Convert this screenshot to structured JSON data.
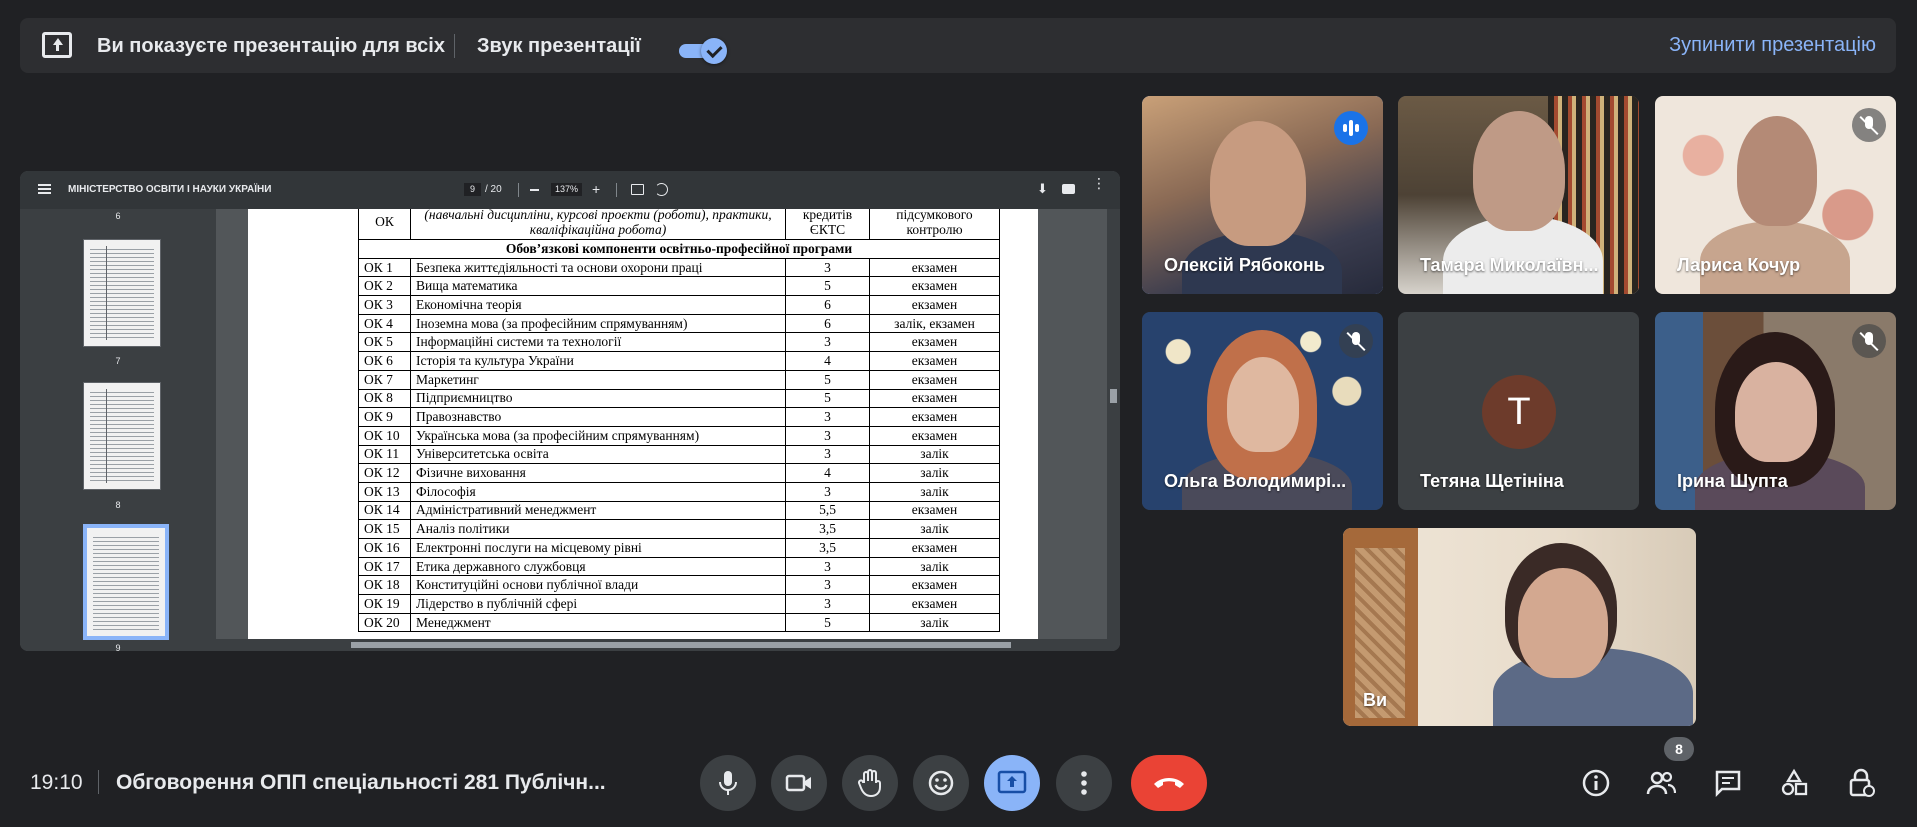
{
  "banner": {
    "message": "Ви показуєте презентацію для всіх",
    "sound_label": "Звук презентації",
    "sound_on": true,
    "stop_label": "Зупинити презентацію"
  },
  "pdf": {
    "title": "МІНІСТЕРСТВО ОСВІТИ І НАУКИ УКРАЇНИ",
    "page": "9",
    "page_total": "/ 20",
    "zoom": "137%",
    "thumbnails": [
      "6",
      "7",
      "8",
      "9"
    ],
    "table": {
      "header": [
        "ОК",
        "(навчальні дисципліни, курсові проєкти (роботи), практики, кваліфікаційна робота)",
        "кредитів ЄКТС",
        "підсумкового контролю"
      ],
      "section": "Обов’язкові компоненти освітньо-професійної програми",
      "rows": [
        [
          "ОК 1",
          "Безпека життєдіяльності та основи охорони праці",
          "3",
          "екзамен"
        ],
        [
          "ОК 2",
          "Вища математика",
          "5",
          "екзамен"
        ],
        [
          "ОК 3",
          "Економічна теорія",
          "6",
          "екзамен"
        ],
        [
          "ОК 4",
          "Іноземна мова (за професійним спрямуванням)",
          "6",
          "залік, екзамен"
        ],
        [
          "ОК 5",
          "Інформаційні системи та технології",
          "3",
          "екзамен"
        ],
        [
          "ОК 6",
          "Історія та культура України",
          "4",
          "екзамен"
        ],
        [
          "ОК 7",
          "Маркетинг",
          "5",
          "екзамен"
        ],
        [
          "ОК 8",
          "Підприємництво",
          "5",
          "екзамен"
        ],
        [
          "ОК 9",
          "Правознавство",
          "3",
          "екзамен"
        ],
        [
          "ОК 10",
          "Українська мова (за професійним спрямуванням)",
          "3",
          "екзамен"
        ],
        [
          "ОК 11",
          "Університетська освіта",
          "3",
          "залік"
        ],
        [
          "ОК 12",
          "Фізичне виховання",
          "4",
          "залік"
        ],
        [
          "ОК 13",
          "Філософія",
          "3",
          "залік"
        ],
        [
          "ОК 14",
          "Адміністративний менеджмент",
          "5,5",
          "екзамен"
        ],
        [
          "ОК 15",
          "Аналіз політики",
          "3,5",
          "залік"
        ],
        [
          "ОК 16",
          " Електронні послуги на місцевому рівні",
          "3,5",
          "екзамен"
        ],
        [
          "ОК 17",
          "Етика державного службовця",
          "3",
          "залік"
        ],
        [
          "ОК 18",
          "Конституційні основи публічної влади",
          "3",
          "екзамен"
        ],
        [
          "ОК 19",
          "Лідерство в публічній сфері",
          "3",
          "екзамен"
        ],
        [
          "ОК 20",
          "Менеджмент",
          "5",
          "залік"
        ]
      ]
    }
  },
  "participants": [
    {
      "name": "Олексій Рябоконь",
      "speaking": true
    },
    {
      "name": "Тамара Миколаївн...",
      "muted": false
    },
    {
      "name": "Лариса Кочур",
      "muted": true
    },
    {
      "name": "Ольга Володимирі...",
      "muted": true
    },
    {
      "name": "Тетяна Щетініна",
      "initial": "T"
    },
    {
      "name": "Ірина Шупта",
      "muted": true
    },
    {
      "name": "Ви"
    }
  ],
  "bottom": {
    "time": "19:10",
    "meeting_title": "Обговорення ОПП спеціальності 281 Публічн...",
    "participant_count": "8"
  },
  "colors": {
    "accent": "#8ab4f8",
    "hangup": "#ea4335",
    "bg": "#202124"
  },
  "icons": [
    "present-icon",
    "mic-icon",
    "camera-icon",
    "hand-icon",
    "emoji-icon",
    "present-now-icon",
    "more-icon",
    "hangup-icon",
    "info-icon",
    "people-icon",
    "chat-icon",
    "activities-icon",
    "host-controls-icon"
  ]
}
